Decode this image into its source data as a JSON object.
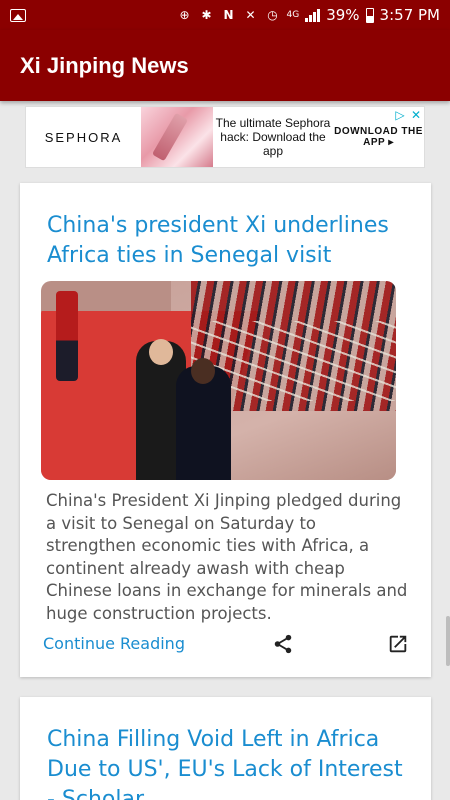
{
  "status_bar": {
    "battery": "39%",
    "time": "3:57 PM",
    "network": "4G",
    "icons": [
      "image-icon",
      "data-saver-icon",
      "bluetooth-icon",
      "nfc-icon",
      "mute-icon",
      "alarm-icon",
      "signal-icon",
      "battery-icon"
    ]
  },
  "app_bar": {
    "title": "Xi Jinping News",
    "color": "#8b0000"
  },
  "ad": {
    "brand": "SEPHORA",
    "text": "The ultimate Sephora hack: Download the app",
    "cta": "DOWNLOAD THE APP ▸",
    "badges": [
      "adchoices-icon",
      "close-icon"
    ]
  },
  "articles": [
    {
      "title": "China's president Xi underlines Africa ties in Senegal visit",
      "description": "China's President Xi Jinping pledged during a visit to Senegal on Saturday to strengthen economic ties with Africa, a continent already awash with cheap Chinese loans in exchange for minerals and huge construction projects.",
      "continue_label": "Continue Reading",
      "actions": [
        "share-icon",
        "open-in-new-icon"
      ]
    },
    {
      "title": "China Filling Void Left in Africa Due to US', EU's Lack of Interest - Scholar"
    }
  ],
  "accent_color": "#1a8dd0"
}
